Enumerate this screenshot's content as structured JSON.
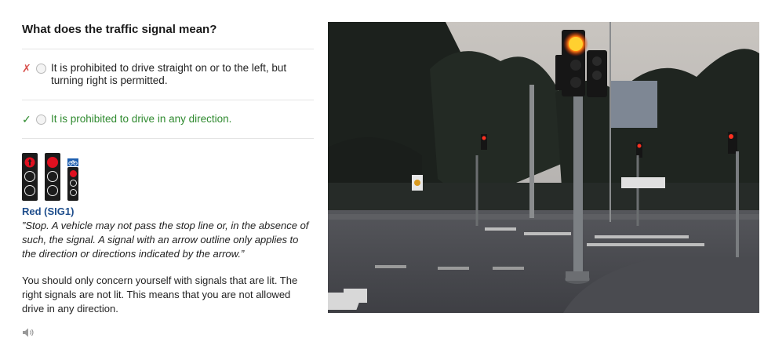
{
  "question": "What does the traffic signal mean?",
  "options": [
    {
      "marker": "✗",
      "text": "It is prohibited to drive straight on or to the left, but turning right is permitted.",
      "status": "wrong"
    },
    {
      "marker": "✓",
      "text": "It is prohibited to drive in any direction.",
      "status": "correct"
    }
  ],
  "signal_info": {
    "name": "Red (SIG1)",
    "quote": "”Stop. A vehicle may not pass the stop line or, in the absence of such, the signal. A signal with an arrow outline only applies to the direction or directions indicated by the arrow.”",
    "explanation": "You should only concern yourself with signals that are lit. The right signals are not lit. This means that you are not allowed drive in any direction."
  },
  "icons": {
    "audio": "speaker-icon",
    "wrong": "cross-icon",
    "correct": "check-icon"
  },
  "colors": {
    "correct_text": "#2f8a2f",
    "wrong_mark": "#d9534f",
    "signal_name": "#1f4e8c",
    "signal_red": "#e01020"
  }
}
